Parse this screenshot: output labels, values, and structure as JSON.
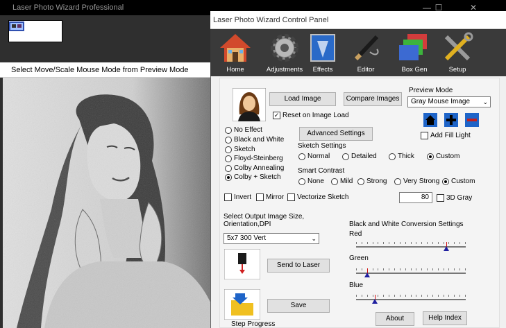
{
  "back_window": {
    "title": "Laser Photo Wizard Professional",
    "preview_header": "Select Move/Scale Mouse Mode from Preview Mode"
  },
  "control_panel": {
    "title": "Laser Photo Wizard Control Panel",
    "toolbar": [
      {
        "label": "Home",
        "icon": "home-icon"
      },
      {
        "label": "Adjustments",
        "icon": "gear-icon"
      },
      {
        "label": "Effects",
        "icon": "effects-icon"
      },
      {
        "label": "Editor",
        "icon": "pen-icon"
      },
      {
        "label": "Box Gen",
        "icon": "box-gen-icon"
      },
      {
        "label": "Setup",
        "icon": "tools-icon"
      }
    ],
    "load_image": "Load Image",
    "compare_images": "Compare Images",
    "reset_on_load": "Reset on Image Load",
    "preview_mode_label": "Preview Mode",
    "preview_mode_value": "Gray Mouse Image",
    "add_fill_light": "Add Fill Light",
    "advanced_settings": "Advanced Settings",
    "effects": [
      "No Effect",
      "Black and White",
      "Sketch",
      "Floyd-Steinberg",
      "Colby Annealing",
      "Colby + Sketch"
    ],
    "effects_selected": "Colby + Sketch",
    "sketch_settings_label": "Sketch Settings",
    "sketch_options": [
      "Normal",
      "Detailed",
      "Thick",
      "Custom"
    ],
    "sketch_selected": "Custom",
    "smart_contrast_label": "Smart Contrast",
    "contrast_options": [
      "None",
      "Mild",
      "Strong",
      "Very Strong",
      "Custom"
    ],
    "contrast_selected": "Custom",
    "invert": "Invert",
    "mirror": "Mirror",
    "vectorize": "Vectorize Sketch",
    "contrast_value": "80",
    "three_d_gray": "3D Gray",
    "output_label_1": "Select Output Image Size,",
    "output_label_2": "Orientation,DPI",
    "output_size": "5x7 300 Vert",
    "send_to_laser": "Send to Laser",
    "save": "Save",
    "step_progress": "Step Progress",
    "bw_settings_label": "Black and White Conversion Settings",
    "sliders": [
      {
        "label": "Red",
        "value": 0.82
      },
      {
        "label": "Green",
        "value": 0.1
      },
      {
        "label": "Blue",
        "value": 0.17
      }
    ],
    "about": "About",
    "help_index": "Help Index"
  },
  "colors": {
    "toolbar_bg": "#3a3a3a",
    "accent_blue": "#1e64c8"
  }
}
